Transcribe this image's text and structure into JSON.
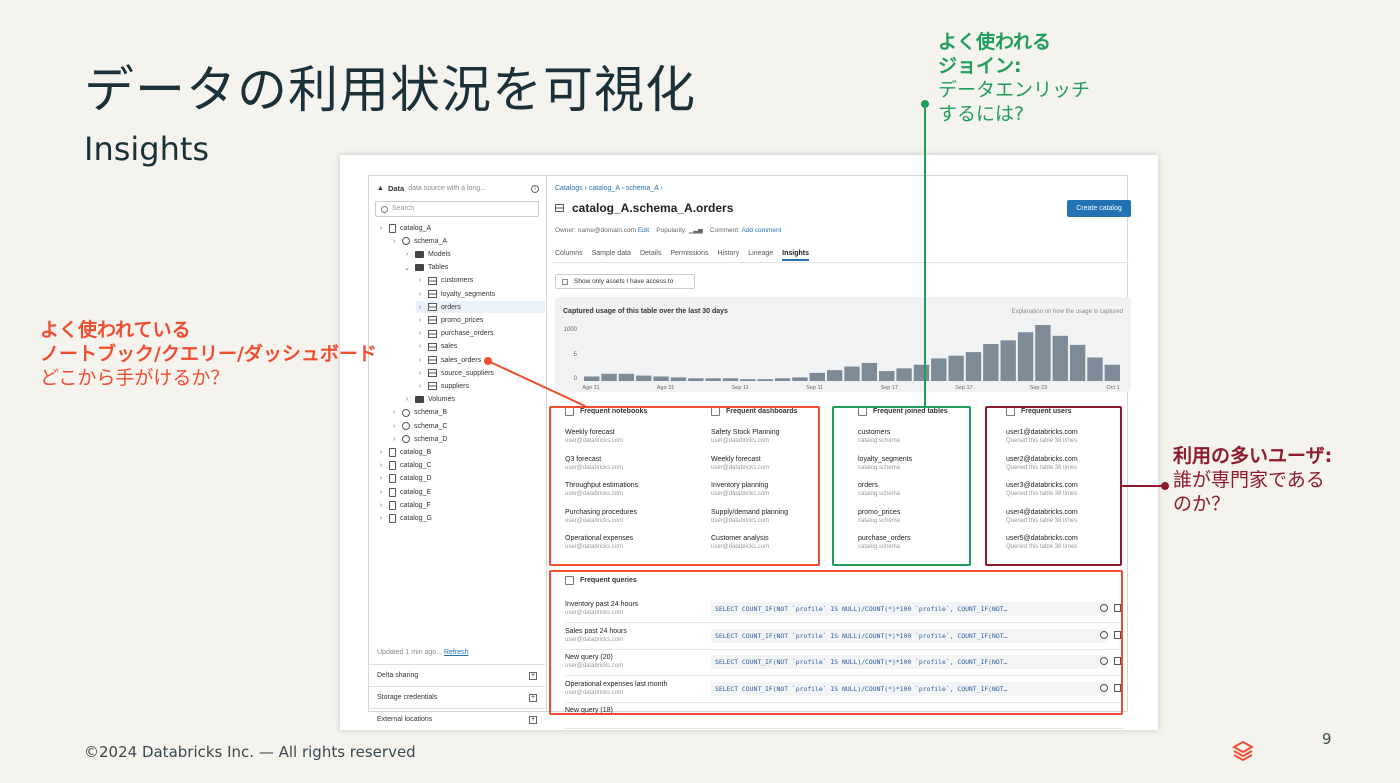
{
  "slide": {
    "title": "データの利用状況を可視化",
    "subtitle": "Insights",
    "footer": "©2024 Databricks Inc. — All rights reserved",
    "page_number": "9"
  },
  "annotations": {
    "notebooks": {
      "line1": "よく使われている",
      "line2": "ノートブック/クエリー/ダッシュボード",
      "line3": "どこから手がけるか？",
      "color": "#f04d30"
    },
    "joins": {
      "line1": "よく使われる",
      "line2": "ジョイン:",
      "line3": "データエンリッチ",
      "line4": "するには?",
      "color": "#1e9e5a"
    },
    "users": {
      "line1": "利用の多いユーザ:",
      "line2": "誰が専門家である",
      "line3": "のか？",
      "color": "#8e1b2d"
    }
  },
  "sidebar": {
    "title": "Data",
    "source_hint": "data source with a long...",
    "search_placeholder": "Search",
    "tree": [
      {
        "label": "catalog_A",
        "depth": 0,
        "icon": "catalog-icon",
        "chev": "›"
      },
      {
        "label": "schema_A",
        "depth": 1,
        "icon": "schema-icon",
        "chev": "›"
      },
      {
        "label": "Models",
        "depth": 2,
        "icon": "folder-icon",
        "chev": "›"
      },
      {
        "label": "Tables",
        "depth": 2,
        "icon": "folder-icon",
        "chev": "⌄"
      },
      {
        "label": "customers",
        "depth": 3,
        "icon": "table-icon",
        "chev": "›"
      },
      {
        "label": "loyalty_segments",
        "depth": 3,
        "icon": "table-icon",
        "chev": "›"
      },
      {
        "label": "orders",
        "depth": 3,
        "icon": "table-icon",
        "chev": "›",
        "selected": true
      },
      {
        "label": "promo_prices",
        "depth": 3,
        "icon": "table-icon",
        "chev": "›"
      },
      {
        "label": "purchase_orders",
        "depth": 3,
        "icon": "table-icon",
        "chev": "›"
      },
      {
        "label": "sales",
        "depth": 3,
        "icon": "table-icon",
        "chev": "›"
      },
      {
        "label": "sales_orders",
        "depth": 3,
        "icon": "table-icon",
        "chev": "›"
      },
      {
        "label": "source_suppliers",
        "depth": 3,
        "icon": "table-icon",
        "chev": "›"
      },
      {
        "label": "suppliers",
        "depth": 3,
        "icon": "table-icon",
        "chev": "›"
      },
      {
        "label": "Volumes",
        "depth": 2,
        "icon": "folder-icon",
        "chev": "›"
      },
      {
        "label": "schema_B",
        "depth": 1,
        "icon": "schema-icon",
        "chev": "›"
      },
      {
        "label": "schema_C",
        "depth": 1,
        "icon": "schema-icon",
        "chev": "›"
      },
      {
        "label": "schema_D",
        "depth": 1,
        "icon": "schema-icon",
        "chev": "›"
      },
      {
        "label": "catalog_B",
        "depth": 0,
        "icon": "catalog-icon",
        "chev": "›"
      },
      {
        "label": "catalog_C",
        "depth": 0,
        "icon": "catalog-icon",
        "chev": "›"
      },
      {
        "label": "catalog_D",
        "depth": 0,
        "icon": "catalog-icon",
        "chev": "›"
      },
      {
        "label": "catalog_E",
        "depth": 0,
        "icon": "catalog-icon",
        "chev": "›"
      },
      {
        "label": "catalog_F",
        "depth": 0,
        "icon": "catalog-icon",
        "chev": "›"
      },
      {
        "label": "catalog_G",
        "depth": 0,
        "icon": "catalog-icon",
        "chev": "›"
      }
    ],
    "updated": "Updated 1 min ago...",
    "refresh": "Refresh",
    "footer_items": [
      "Delta sharing",
      "Storage credentials",
      "External locations"
    ]
  },
  "main": {
    "breadcrumb": "Catalogs › catalog_A › schema_A ›",
    "table_name": "catalog_A.schema_A.orders",
    "create_button": "Create catalog",
    "owner_label": "Owner: name@domain.com",
    "owner_edit": "Edit",
    "popularity_label": "Popularity:",
    "comment_label": "Comment:",
    "comment_add": "Add comment",
    "tabs": [
      "Columns",
      "Sample data",
      "Details",
      "Permissions",
      "History",
      "Lineage",
      "Insights"
    ],
    "active_tab": "Insights",
    "checkbox_label": "Show only assets I have access to"
  },
  "chart_data": {
    "type": "bar",
    "title": "Captured usage of this table over the last 30 days",
    "explanation": "Explanation on how the usage is captured",
    "y_ticks": [
      "1000",
      "5",
      "0"
    ],
    "x_ticks": [
      "Ago 31",
      "Ago 31",
      "Sep 11",
      "Sep 11",
      "Sep 17",
      "Sep 17",
      "Sep 23",
      "Oct 1"
    ],
    "values": [
      5,
      8,
      8,
      6,
      5,
      4,
      3,
      3,
      3,
      2,
      2,
      3,
      4,
      9,
      12,
      16,
      20,
      11,
      14,
      18,
      25,
      28,
      32,
      41,
      45,
      54,
      62,
      50,
      40,
      26,
      18
    ],
    "color": "#7d8a97"
  },
  "notebooks": {
    "title": "Frequent notebooks",
    "items": [
      {
        "name": "Weekly forecast",
        "user": "user@databricks.com"
      },
      {
        "name": "Q3 forecast",
        "user": "user@databricks.com"
      },
      {
        "name": "Throughput estimations",
        "user": "user@databricks.com"
      },
      {
        "name": "Purchasing procedures",
        "user": "user@databricks.com"
      },
      {
        "name": "Operational expenses",
        "user": "user@databricks.com"
      }
    ]
  },
  "dashboards": {
    "title": "Frequent dashboards",
    "items": [
      {
        "name": "Safety Stock Planning",
        "user": "user@databricks.com"
      },
      {
        "name": "Weekly forecast",
        "user": "user@databricks.com"
      },
      {
        "name": "Inventory planning",
        "user": "user@databricks.com"
      },
      {
        "name": "Supply/demand planning",
        "user": "user@databricks.com"
      },
      {
        "name": "Customer analysis",
        "user": "user@databricks.com"
      }
    ]
  },
  "joined_tables": {
    "title": "Frequent joined tables",
    "items": [
      {
        "name": "customers",
        "user": "catalog.schema"
      },
      {
        "name": "loyalty_segments",
        "user": "catalog.schema"
      },
      {
        "name": "orders",
        "user": "catalog.schema"
      },
      {
        "name": "promo_prices",
        "user": "catalog.schema"
      },
      {
        "name": "purchase_orders",
        "user": "catalog.schema"
      }
    ]
  },
  "users": {
    "title": "Frequent users",
    "items": [
      {
        "name": "user1@databricks.com",
        "user": "Queried this table 38 times"
      },
      {
        "name": "user2@databricks.com",
        "user": "Queried this table 38 times"
      },
      {
        "name": "user3@databricks.com",
        "user": "Queried this table 38 times"
      },
      {
        "name": "user4@databricks.com",
        "user": "Queried this table 38 times"
      },
      {
        "name": "user5@databricks.com",
        "user": "Queried this table 38 times"
      }
    ]
  },
  "queries": {
    "title": "Frequent queries",
    "items": [
      {
        "name": "Inventory past 24 hours",
        "user": "user@databricks.com",
        "sql": "SELECT COUNT_IF(NOT `profile` IS NULL)/COUNT(*)*100 `profile`, COUNT_IF(NOT…"
      },
      {
        "name": "Sales past 24 hours",
        "user": "user@databricks.com",
        "sql": "SELECT COUNT_IF(NOT `profile` IS NULL)/COUNT(*)*100 `profile`, COUNT_IF(NOT…"
      },
      {
        "name": "New query (20)",
        "user": "user@databricks.com",
        "sql": "SELECT COUNT_IF(NOT `profile` IS NULL)/COUNT(*)*100 `profile`, COUNT_IF(NOT…"
      },
      {
        "name": "Operational expenses last month",
        "user": "user@databricks.com",
        "sql": "SELECT COUNT_IF(NOT `profile` IS NULL)/COUNT(*)*100 `profile`, COUNT_IF(NOT…"
      },
      {
        "name": "New query (18)",
        "user": "",
        "sql": ""
      }
    ]
  }
}
